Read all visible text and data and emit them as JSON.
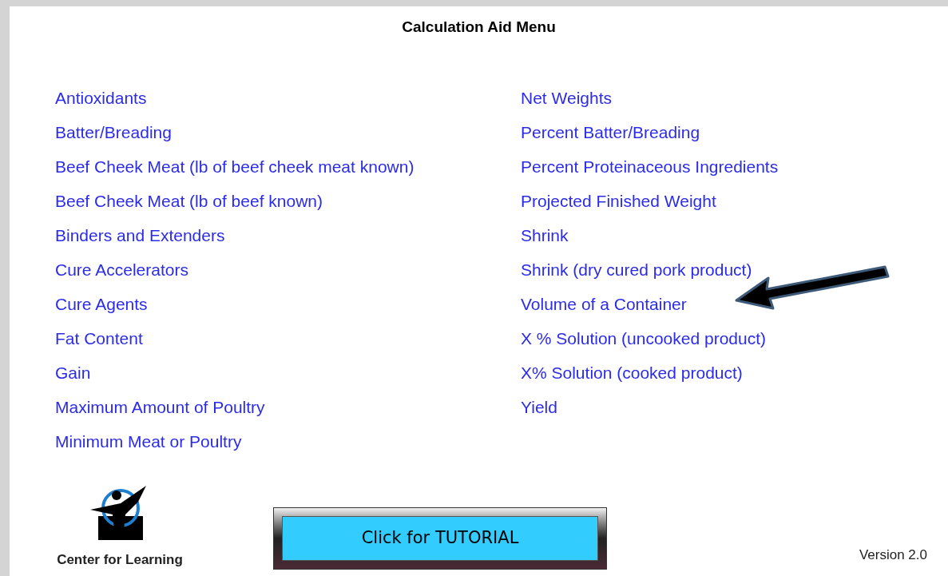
{
  "title": "Calculation Aid Menu",
  "left_links": [
    "Antioxidants",
    "Batter/Breading",
    "Beef Cheek Meat (lb of beef cheek meat known)",
    "Beef Cheek Meat (lb of beef known)",
    "Binders and Extenders",
    "Cure Accelerators",
    "Cure Agents",
    "Fat Content",
    "Gain",
    "Maximum Amount of Poultry",
    "Minimum Meat or Poultry"
  ],
  "right_links": [
    "Net Weights",
    "Percent Batter/Breading",
    "Percent Proteinaceous Ingredients",
    "Projected Finished Weight",
    "Shrink",
    "Shrink (dry cured pork product)",
    "Volume of a Container",
    "X % Solution (uncooked product)",
    "X% Solution (cooked product)",
    "Yield"
  ],
  "logo_caption": "Center for Learning",
  "tutorial_button": "Click for TUTORIAL",
  "version": "Version 2.0"
}
